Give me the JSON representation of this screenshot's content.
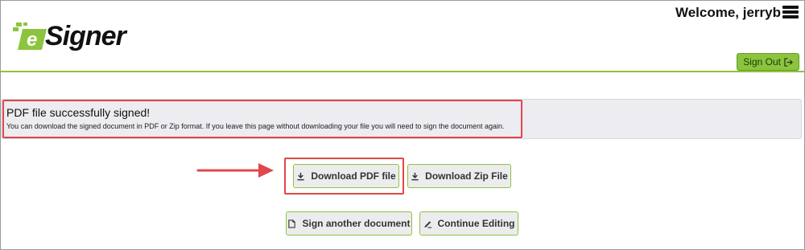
{
  "header": {
    "welcome_text": "Welcome, jerryb",
    "logo_text": "eSigner",
    "sign_out_label": "Sign Out"
  },
  "alert": {
    "title": "PDF file successfully signed!",
    "message": "You can download the signed document in PDF or Zip format. If you leave this page without downloading your file you will need to sign the document again."
  },
  "actions": {
    "download_pdf_label": "Download PDF file",
    "download_zip_label": "Download Zip File",
    "sign_another_label": "Sign another document",
    "continue_editing_label": "Continue Editing"
  },
  "colors": {
    "accent_green": "#8cc43f",
    "highlight_red": "#e0474c",
    "alert_bg": "#ececf1"
  },
  "icons": [
    "hamburger-menu-icon",
    "sign-out-icon",
    "download-icon",
    "document-icon",
    "pencil-icon",
    "annotation-arrow"
  ]
}
